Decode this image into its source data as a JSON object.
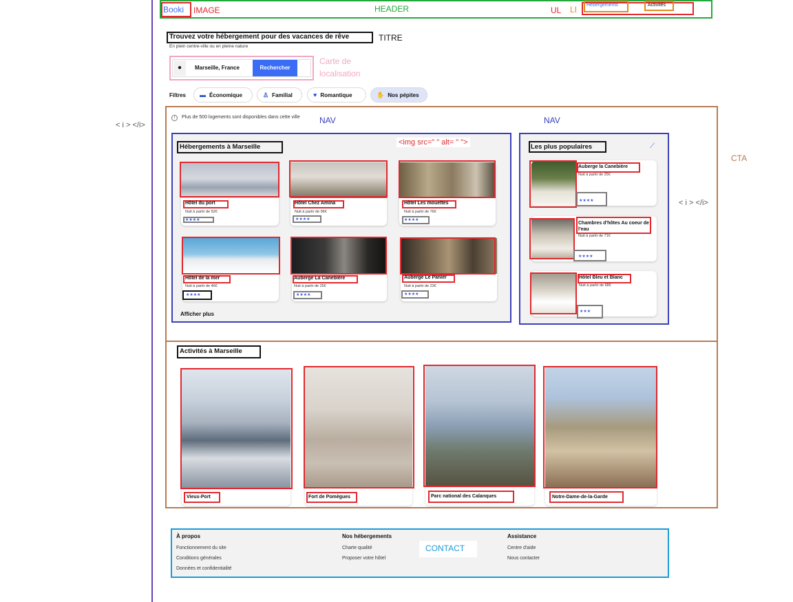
{
  "header": {
    "logo": "Booki",
    "nav_items": [
      "Hébergements",
      "Activités"
    ]
  },
  "annotations": {
    "image": "IMAGE",
    "header": "HEADER",
    "ul": "UL",
    "li": "LI",
    "titre": "TITRE",
    "carte": "Carte de localisation",
    "nav_left": "NAV",
    "nav_right": "NAV",
    "cta": "CTA",
    "icon_left": "< i > </i>",
    "icon_right": "< i > </i>",
    "img_tag": "<img src=\" \" alt= \" \">",
    "contact": "CONTACT"
  },
  "hero": {
    "title": "Trouvez votre hébergement pour des vacances de rêve",
    "subtitle": "En plein centre-ville ou en pleine nature"
  },
  "search": {
    "location": "Marseille, France",
    "button": "Rechercher"
  },
  "filters": {
    "label": "Filtres",
    "items": [
      {
        "label": "Économique",
        "icon": "money-icon"
      },
      {
        "label": "Familial",
        "icon": "person-icon"
      },
      {
        "label": "Romantique",
        "icon": "heart-icon"
      },
      {
        "label": "Nos pépites",
        "icon": "hand-icon"
      }
    ]
  },
  "info": {
    "text": "Plus de 500 logements sont disponibles dans cette ville"
  },
  "hebergements": {
    "title": "Hébergements à Marseille",
    "more": "Afficher plus",
    "items": [
      {
        "name": "Hôtel du port",
        "price": "Nuit à partir de 52€",
        "stars": "★★★★"
      },
      {
        "name": "Hôtel Chez Amina",
        "price": "Nuit à partir de 96€",
        "stars": "★★★★"
      },
      {
        "name": "Hôtel Les mouettes",
        "price": "Nuit à partir de 76€",
        "stars": "★★★★"
      },
      {
        "name": "Hôtel de la mer",
        "price": "Nuit à partir de 46€",
        "stars": "★★★★"
      },
      {
        "name": "Auberge La Canebière",
        "price": "Nuit à partir de 25€",
        "stars": "★★★★"
      },
      {
        "name": "Auberge Le Panier",
        "price": "Nuit à partir de 23€",
        "stars": "★★★★"
      }
    ]
  },
  "populaires": {
    "title": "Les plus populaires",
    "items": [
      {
        "name": "Auberge la Canebière",
        "price": "Nuit à partir de 25€",
        "stars": "★★★★"
      },
      {
        "name": "Chambres d'hôtes Au coeur de l'eau",
        "price": "Nuit à partir de 71€",
        "stars": "★★★★"
      },
      {
        "name": "Hôtel Bleu et Blanc",
        "price": "Nuit à partir de 68€",
        "stars": "★★★"
      }
    ]
  },
  "activites": {
    "title": "Activités à Marseille",
    "items": [
      "Vieux-Port",
      "Fort de Pomègues",
      "Parc national des Calanques",
      "Notre-Dame-de-la-Garde"
    ]
  },
  "footer": {
    "columns": [
      {
        "title": "À propos",
        "links": [
          "Fonctionnement du site",
          "Conditions générales",
          "Données et confidentialité"
        ]
      },
      {
        "title": "Nos hébergements",
        "links": [
          "Charte qualité",
          "Proposer votre hôtel"
        ]
      },
      {
        "title": "Assistance",
        "links": [
          "Centre d'aide",
          "Nous contacter"
        ]
      }
    ]
  },
  "colors": {
    "accent": "#3b6cf5",
    "annotation_red": "#e0282e",
    "header_green": "#22a83a",
    "nav_blue": "#3a3fb8",
    "cta_brown": "#b77b52",
    "contact_blue": "#1a9ad6",
    "carte_pink": "#f2a6c4"
  }
}
